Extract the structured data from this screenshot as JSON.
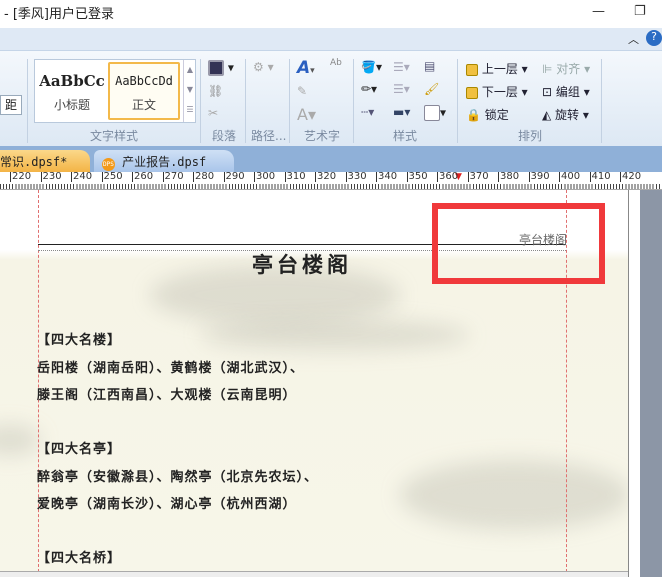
{
  "window": {
    "title": "- [季风]用户已登录"
  },
  "ribbon": {
    "styles": [
      {
        "sample": "AaBbCc",
        "label": "小标题"
      },
      {
        "sample": "AaBbCcDd",
        "label": "正文"
      }
    ],
    "partial_left_button": "距",
    "groups": [
      "文字样式",
      "段落",
      "路径...",
      "艺术字",
      "样式",
      "排列"
    ],
    "arrange": {
      "bring_forward": "上一层",
      "send_backward": "下一层",
      "lock": "锁定",
      "align": "对齐",
      "group": "编组",
      "rotate": "旋转"
    }
  },
  "doc_tabs": [
    {
      "label": "常识.dpsf*",
      "active": true
    },
    {
      "label": "产业报告.dpsf",
      "active": false,
      "badge": "DPS"
    }
  ],
  "ruler": {
    "labels": [
      "220",
      "230",
      "240",
      "250",
      "260",
      "270",
      "280",
      "290",
      "300",
      "310",
      "320",
      "330",
      "340",
      "350",
      "360",
      "370",
      "380",
      "390",
      "400",
      "410",
      "420"
    ]
  },
  "document": {
    "header": "亭台楼阁",
    "title": "亭台楼阁",
    "paragraphs": [
      "【四大名楼】",
      "岳阳楼（湖南岳阳）、黄鹤楼（湖北武汉）、",
      "滕王阁（江西南昌）、大观楼（云南昆明）",
      "【四大名亭】",
      "醉翁亭（安徽滁县）、陶然亭（北京先农坛）、",
      "爱晚亭（湖南长沙）、湖心亭（杭州西湖）",
      "【四大名桥】"
    ]
  },
  "colors": {
    "highlight": "#f0393b",
    "active_tab": "#f7c266"
  }
}
